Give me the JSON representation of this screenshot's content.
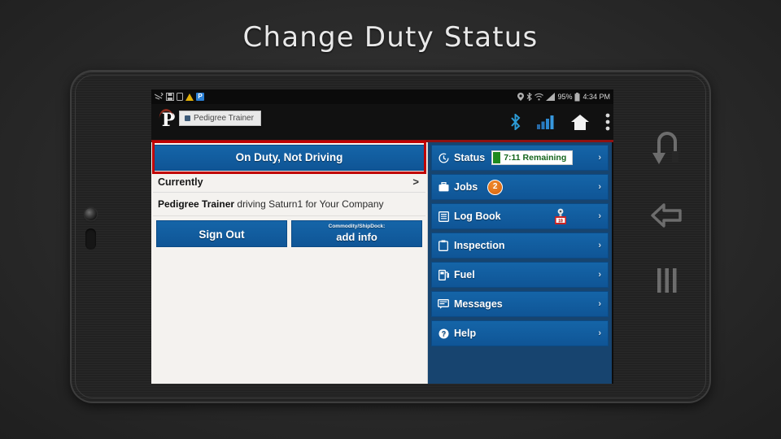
{
  "slide": {
    "title": "Change Duty Status",
    "background_color": "#2b2b2b",
    "title_color": "#e8e8e8"
  },
  "device": {
    "type": "android-tablet",
    "nav_buttons": [
      {
        "name": "undo-icon",
        "label": "Undo"
      },
      {
        "name": "back-icon",
        "label": "Back"
      },
      {
        "name": "recent-apps-icon",
        "label": "Recent Apps"
      }
    ],
    "hardware": [
      {
        "name": "front-camera",
        "label": "Camera"
      },
      {
        "name": "side-button",
        "label": "Button"
      }
    ]
  },
  "status_bar": {
    "left_icons": [
      "sync-icon",
      "save-icon",
      "sim-icon",
      "warning-icon",
      "pedigree-notification-icon"
    ],
    "right_icons": [
      "location-icon",
      "bluetooth-icon",
      "wifi-icon",
      "signal-icon"
    ],
    "battery_percent": "95%",
    "time": "4:34 PM"
  },
  "app_bar": {
    "logo_letter": "P",
    "tooltip": "Pedigree Trainer",
    "icons": [
      "bluetooth-icon",
      "signal-bars-icon",
      "home-icon",
      "overflow-menu-icon"
    ]
  },
  "left_panel": {
    "duty_status_button": "On Duty, Not Driving",
    "currently_label": "Currently",
    "currently_chevron": ">",
    "driver_line": {
      "driver": "Pedigree Trainer",
      "middle": "driving",
      "vehicle": "Saturn1",
      "tail": "for Your Company"
    },
    "sign_out_button": "Sign Out",
    "add_info_button": {
      "caption": "Commodity/ShipDock:",
      "label": "add info"
    }
  },
  "right_panel": {
    "background_color": "#17446f",
    "items": [
      {
        "label": "Status",
        "icon": "clock-icon",
        "chevron": "›",
        "pill": "7:11 Remaining"
      },
      {
        "label": "Jobs",
        "icon": "briefcase-icon",
        "chevron": "›",
        "badge": "2"
      },
      {
        "label": "Log Book",
        "icon": "book-icon",
        "chevron": "›",
        "extra_icon": "log-alert-icon"
      },
      {
        "label": "Inspection",
        "icon": "clipboard-icon",
        "chevron": "›"
      },
      {
        "label": "Fuel",
        "icon": "fuel-pump-icon",
        "chevron": "›"
      },
      {
        "label": "Messages",
        "icon": "message-icon",
        "chevron": "›"
      },
      {
        "label": "Help",
        "icon": "question-circle-icon",
        "chevron": "›"
      }
    ]
  },
  "colors": {
    "button_blue": "#1565a8",
    "panel_navy": "#17446f",
    "highlight_red": "#c00000",
    "badge_orange": "#e0740f",
    "status_green": "#1f8a1f",
    "panel_cream": "#f4f2ef"
  }
}
